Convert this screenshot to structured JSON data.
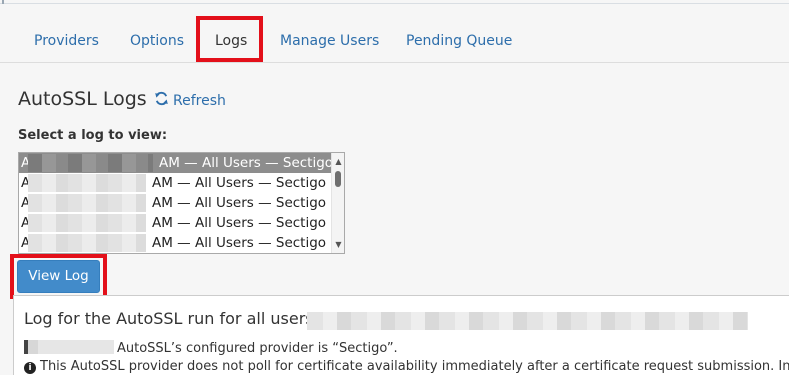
{
  "tabs": [
    {
      "label": "Providers"
    },
    {
      "label": "Options"
    },
    {
      "label": "Logs"
    },
    {
      "label": "Manage Users"
    },
    {
      "label": "Pending Queue"
    }
  ],
  "header": {
    "title": "AutoSSL Logs",
    "refresh_label": "Refresh"
  },
  "log_select": {
    "label": "Select a log to view:",
    "options": [
      {
        "lead": "A",
        "suffix": "AM — All Users — Sectigo"
      },
      {
        "lead": "A",
        "suffix": "AM — All Users — Sectigo"
      },
      {
        "lead": "A",
        "suffix": "AM — All Users — Sectigo"
      },
      {
        "lead": "A",
        "suffix": "AM — All Users — Sectigo"
      },
      {
        "lead": "A",
        "suffix": "AM — All Users — Sectigo"
      }
    ]
  },
  "view_log_label": "View Log",
  "log": {
    "heading": "Log for the AutoSSL run for all users: T",
    "provider_line": "AutoSSL’s configured provider is “Sectigo”.",
    "info_line": "This AutoSSL provider does not poll for certificate availability immediately after a certificate request submission. Ins"
  },
  "colors": {
    "link": "#2d6eab",
    "highlight_box": "#e3101a",
    "primary_button": "#428bca",
    "selected_option": "#8d8d8d"
  },
  "icons": {
    "refresh": "refresh-icon",
    "info": "info-icon"
  }
}
